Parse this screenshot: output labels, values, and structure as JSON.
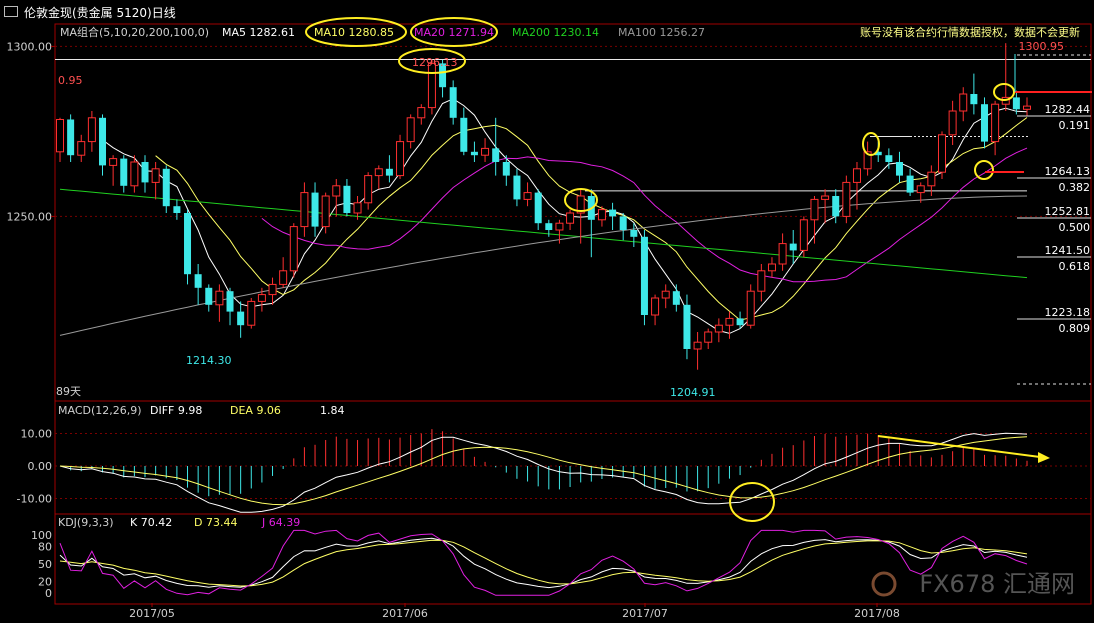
{
  "window": {
    "title": "伦敦金现(贵金属 5120)日线"
  },
  "notice": "账号没有该合约行情数据授权，数据不会更新",
  "watermark": "FX678 汇通网",
  "colors": {
    "up": "#ff3030",
    "down": "#3ee8e8",
    "ma5": "#ffffff",
    "ma10": "#ffff66",
    "ma20": "#e020e0",
    "ma200": "#20d020",
    "ma100": "#9a9a9a",
    "highlight": "#ffee22",
    "fib": "#ffffff"
  },
  "main": {
    "legend": {
      "group": "MA组合(5,10,20,200,100,0)",
      "ma5": "MA5 1282.61",
      "ma10": "MA10 1280.85",
      "ma20": "MA20 1271.94",
      "ma200": "MA200 1230.14",
      "ma100": "MA100 1256.27"
    },
    "left_label_top": "0.95",
    "days_label": "89天",
    "yticks": [
      "1300.00",
      "1250.00"
    ],
    "annotations": {
      "high": "1296.13",
      "low1": "1214.30",
      "low2": "1204.91",
      "last_high": "1300.95"
    },
    "fib": [
      {
        "price": "1282.44",
        "ratio": "0.191"
      },
      {
        "price": "1264.13",
        "ratio": "0.382"
      },
      {
        "price": "1252.81",
        "ratio": "0.500"
      },
      {
        "price": "1241.50",
        "ratio": "0.618"
      },
      {
        "price": "1223.18",
        "ratio": "0.809"
      }
    ]
  },
  "macd_panel": {
    "legend": {
      "name": "MACD(12,26,9)",
      "diff": "DIFF  9.98",
      "dea": "DEA  9.06",
      "macd": "1.84"
    },
    "yticks": [
      "10.00",
      "0.00",
      "-10.00"
    ]
  },
  "kdj_panel": {
    "legend": {
      "name": "KDJ(9,3,3)",
      "k": "K  70.42",
      "d": "D  73.44",
      "j": "J  64.39"
    },
    "yticks": [
      "100",
      "80",
      "50",
      "20",
      "0"
    ]
  },
  "xaxis": [
    "2017/05",
    "2017/06",
    "2017/07",
    "2017/08"
  ],
  "chart_data": [
    {
      "type": "candlestick",
      "title": "伦敦金现(贵金属 5120)日线",
      "ylim": [
        1196,
        1306
      ],
      "candles": [
        [
          1269.0,
          1279.0,
          1266.0,
          1278.5
        ],
        [
          1278.5,
          1280.0,
          1266.0,
          1268.0
        ],
        [
          1268.0,
          1274.0,
          1266.0,
          1272.0
        ],
        [
          1272.0,
          1281.0,
          1269.0,
          1279.0
        ],
        [
          1279.0,
          1280.0,
          1262.0,
          1265.0
        ],
        [
          1265.0,
          1268.0,
          1259.0,
          1267.0
        ],
        [
          1267.0,
          1268.0,
          1257.0,
          1259.0
        ],
        [
          1259.0,
          1268.0,
          1257.0,
          1266.0
        ],
        [
          1266.0,
          1268.0,
          1257.0,
          1260.0
        ],
        [
          1260.0,
          1266.0,
          1255.0,
          1264.0
        ],
        [
          1264.0,
          1265.0,
          1251.0,
          1253.0
        ],
        [
          1253.0,
          1255.0,
          1249.0,
          1251.0
        ],
        [
          1251.0,
          1252.0,
          1230.0,
          1233.0
        ],
        [
          1233.0,
          1236.0,
          1224.0,
          1229.0
        ],
        [
          1229.0,
          1230.0,
          1222.0,
          1224.0
        ],
        [
          1224.0,
          1230.0,
          1219.0,
          1228.0
        ],
        [
          1228.0,
          1229.0,
          1218.0,
          1222.0
        ],
        [
          1222.0,
          1225.0,
          1214.3,
          1218.0
        ],
        [
          1218.0,
          1226.0,
          1217.0,
          1225.0
        ],
        [
          1225.0,
          1229.0,
          1222.0,
          1227.0
        ],
        [
          1227.0,
          1232.0,
          1224.0,
          1230.0
        ],
        [
          1230.0,
          1238.0,
          1229.0,
          1234.0
        ],
        [
          1234.0,
          1248.0,
          1232.0,
          1247.0
        ],
        [
          1247.0,
          1260.0,
          1244.0,
          1257.0
        ],
        [
          1257.0,
          1260.0,
          1244.0,
          1247.0
        ],
        [
          1247.0,
          1257.0,
          1245.0,
          1256.0
        ],
        [
          1256.0,
          1261.0,
          1250.0,
          1259.0
        ],
        [
          1259.0,
          1261.0,
          1250.0,
          1251.0
        ],
        [
          1251.0,
          1256.0,
          1249.0,
          1254.0
        ],
        [
          1254.0,
          1263.0,
          1252.0,
          1262.0
        ],
        [
          1262.0,
          1265.0,
          1258.0,
          1264.0
        ],
        [
          1264.0,
          1268.0,
          1260.0,
          1262.0
        ],
        [
          1262.0,
          1274.0,
          1261.0,
          1272.0
        ],
        [
          1272.0,
          1280.0,
          1270.0,
          1279.0
        ],
        [
          1279.0,
          1283.0,
          1277.0,
          1282.0
        ],
        [
          1282.0,
          1296.13,
          1280.0,
          1295.0
        ],
        [
          1295.0,
          1296.0,
          1285.0,
          1288.0
        ],
        [
          1288.0,
          1290.0,
          1277.0,
          1279.0
        ],
        [
          1279.0,
          1282.0,
          1268.0,
          1269.0
        ],
        [
          1269.0,
          1272.0,
          1266.0,
          1268.0
        ],
        [
          1268.0,
          1273.0,
          1266.0,
          1270.0
        ],
        [
          1270.0,
          1279.0,
          1262.0,
          1266.0
        ],
        [
          1266.0,
          1268.0,
          1259.0,
          1262.0
        ],
        [
          1262.0,
          1264.0,
          1253.0,
          1255.0
        ],
        [
          1255.0,
          1260.0,
          1253.0,
          1257.0
        ],
        [
          1257.0,
          1258.0,
          1246.0,
          1248.0
        ],
        [
          1248.0,
          1249.0,
          1244.0,
          1246.0
        ],
        [
          1246.0,
          1249.0,
          1242.0,
          1248.0
        ],
        [
          1248.0,
          1252.0,
          1246.0,
          1251.0
        ],
        [
          1251.0,
          1258.0,
          1242.0,
          1256.0
        ],
        [
          1256.0,
          1258.0,
          1238.0,
          1249.0
        ],
        [
          1249.0,
          1253.0,
          1247.0,
          1252.0
        ],
        [
          1252.0,
          1254.0,
          1246.0,
          1250.0
        ],
        [
          1250.0,
          1251.0,
          1243.0,
          1246.0
        ],
        [
          1246.0,
          1248.0,
          1241.0,
          1244.0
        ],
        [
          1244.0,
          1246.0,
          1218.0,
          1221.0
        ],
        [
          1221.0,
          1227.0,
          1218.0,
          1226.0
        ],
        [
          1226.0,
          1230.0,
          1223.0,
          1228.0
        ],
        [
          1228.0,
          1230.0,
          1222.0,
          1224.0
        ],
        [
          1224.0,
          1227.0,
          1208.0,
          1211.0
        ],
        [
          1211.0,
          1216.0,
          1204.91,
          1213.0
        ],
        [
          1213.0,
          1217.0,
          1211.0,
          1216.0
        ],
        [
          1216.0,
          1220.0,
          1213.0,
          1218.0
        ],
        [
          1218.0,
          1222.0,
          1214.0,
          1220.0
        ],
        [
          1220.0,
          1222.0,
          1217.0,
          1218.0
        ],
        [
          1218.0,
          1230.0,
          1217.0,
          1228.0
        ],
        [
          1228.0,
          1236.0,
          1225.0,
          1234.0
        ],
        [
          1234.0,
          1238.0,
          1232.0,
          1236.0
        ],
        [
          1236.0,
          1245.0,
          1234.0,
          1242.0
        ],
        [
          1242.0,
          1246.0,
          1236.0,
          1240.0
        ],
        [
          1240.0,
          1250.0,
          1238.0,
          1249.0
        ],
        [
          1249.0,
          1256.0,
          1242.0,
          1255.0
        ],
        [
          1255.0,
          1258.0,
          1248.0,
          1256.0
        ],
        [
          1256.0,
          1258.0,
          1248.0,
          1250.0
        ],
        [
          1250.0,
          1262.0,
          1248.0,
          1260.0
        ],
        [
          1260.0,
          1266.0,
          1252.0,
          1264.0
        ],
        [
          1264.0,
          1272.0,
          1262.0,
          1269.0
        ],
        [
          1269.0,
          1272.0,
          1266.0,
          1268.0
        ],
        [
          1268.0,
          1270.0,
          1264.0,
          1266.0
        ],
        [
          1266.0,
          1269.0,
          1260.0,
          1262.0
        ],
        [
          1262.0,
          1264.0,
          1256.0,
          1257.0
        ],
        [
          1257.0,
          1260.0,
          1254.0,
          1259.0
        ],
        [
          1259.0,
          1265.0,
          1256.0,
          1263.0
        ],
        [
          1263.0,
          1275.0,
          1261.0,
          1274.0
        ],
        [
          1274.0,
          1284.0,
          1271.0,
          1281.0
        ],
        [
          1281.0,
          1288.0,
          1278.0,
          1286.0
        ],
        [
          1286.0,
          1292.0,
          1280.0,
          1283.0
        ],
        [
          1283.0,
          1285.0,
          1270.0,
          1272.0
        ],
        [
          1272.0,
          1284.0,
          1268.0,
          1283.0
        ],
        [
          1283.0,
          1300.95,
          1281.0,
          1285.0
        ],
        [
          1285.0,
          1287.0,
          1280.0,
          1281.5
        ],
        [
          1281.5,
          1285.0,
          1279.5,
          1282.44
        ]
      ]
    },
    {
      "type": "bar",
      "title": "MACD(12,26,9)",
      "ylim": [
        -14,
        14
      ]
    },
    {
      "type": "line",
      "title": "KDJ(9,3,3)",
      "ylim": [
        -5,
        110
      ]
    }
  ]
}
